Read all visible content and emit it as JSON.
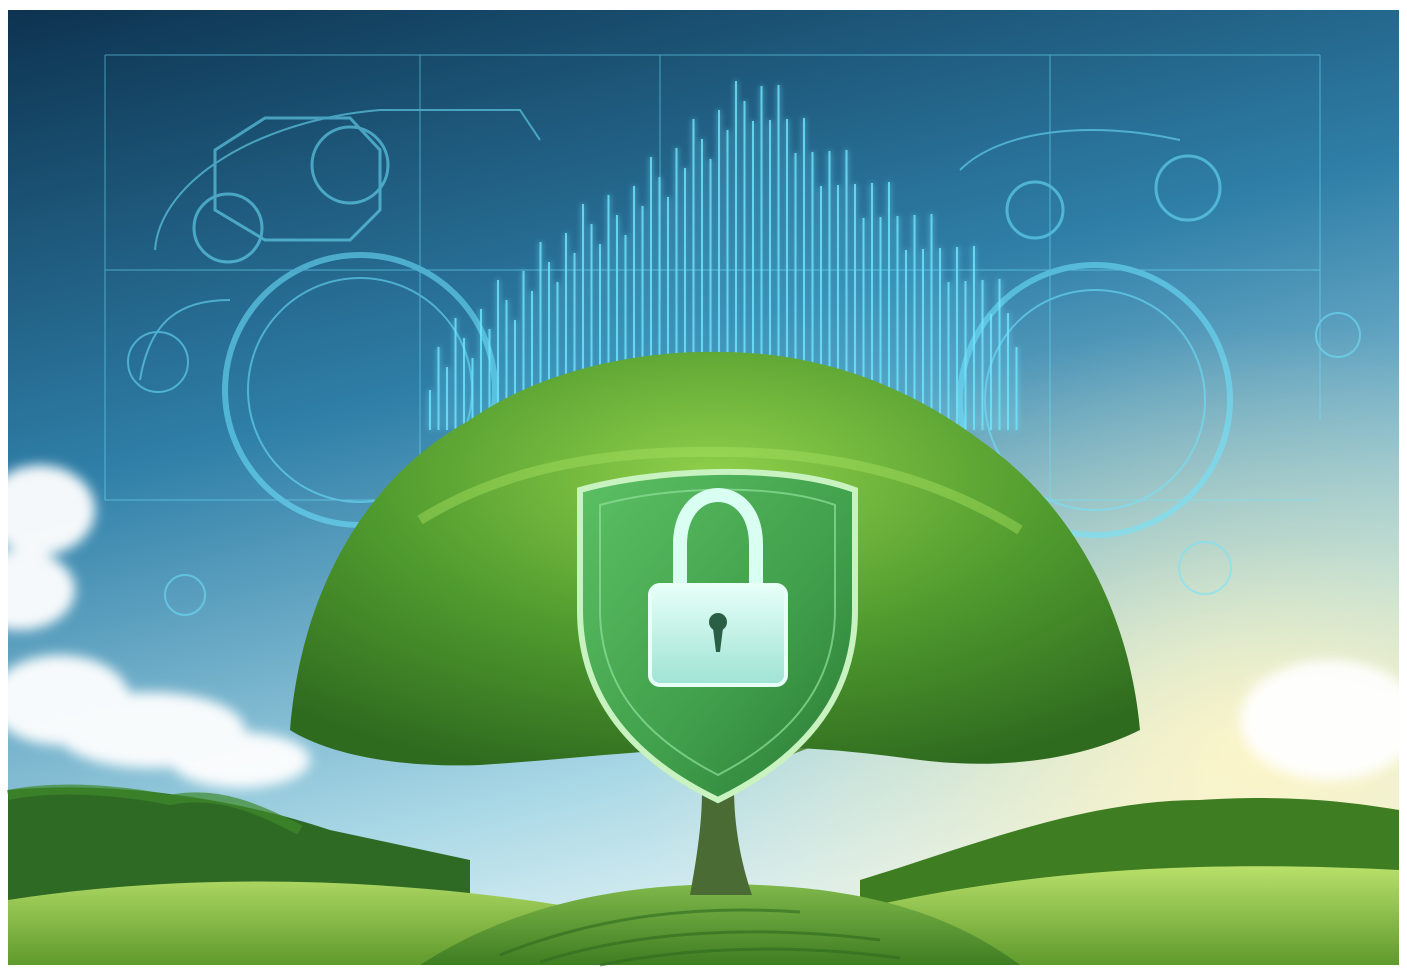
{
  "scene": {
    "subject": "shield-lock-tree",
    "palette": {
      "sky_top": "#0d3350",
      "sky_mid": "#2f7fa8",
      "sky_horizon": "#d9eef2",
      "sun_glow": "#fff6c8",
      "holo_cyan": "#6fe6ff",
      "holo_blue": "#2aa6d6",
      "canopy_dark": "#2f6b1f",
      "canopy_mid": "#4f9a2e",
      "canopy_light": "#8fcf4a",
      "shield_green": "#3f9e4a",
      "shield_edge": "#c8f2c0",
      "lock_face": "#bff3ea",
      "field_light": "#a8d75a",
      "field_dark": "#5f9a2c",
      "forest": "#2e6a24",
      "cloud": "#ffffff"
    },
    "icons": [
      "cloud-icon",
      "tree-icon",
      "shield-icon",
      "padlock-icon",
      "keyhole-icon",
      "hologram-circuit-icon"
    ]
  }
}
